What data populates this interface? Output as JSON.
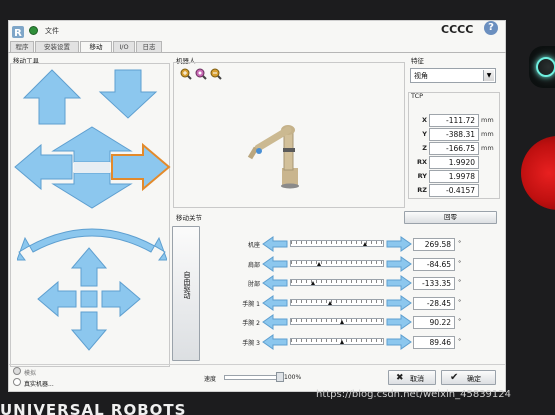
{
  "window": {
    "file_menu": "文件",
    "robot_name": "CCCC"
  },
  "tabs": [
    {
      "label": "程序"
    },
    {
      "label": "安装设置"
    },
    {
      "label": "移动"
    },
    {
      "label": "I/O"
    },
    {
      "label": "日志"
    }
  ],
  "move_tool": {
    "title": "移动工具"
  },
  "robot_view": {
    "title": "机器人"
  },
  "feature": {
    "title": "特征",
    "selected": "视角"
  },
  "tcp": {
    "title": "TCP",
    "rows": [
      {
        "label": "X",
        "value": "-111.72",
        "unit": "mm"
      },
      {
        "label": "Y",
        "value": "-388.31",
        "unit": "mm"
      },
      {
        "label": "Z",
        "value": "-166.75",
        "unit": "mm"
      },
      {
        "label": "RX",
        "value": "1.9920",
        "unit": ""
      },
      {
        "label": "RY",
        "value": "1.9978",
        "unit": ""
      },
      {
        "label": "RZ",
        "value": "-0.4157",
        "unit": ""
      }
    ]
  },
  "home_button": "回零",
  "joints": {
    "title": "移动关节",
    "freedrive_label": "自由驱动",
    "rows": [
      {
        "label": "机座",
        "value": "269.58",
        "unit": "°",
        "position": 0.8
      },
      {
        "label": "肩部",
        "value": "-84.65",
        "unit": "°",
        "position": 0.3
      },
      {
        "label": "肘部",
        "value": "-133.35",
        "unit": "°",
        "position": 0.24
      },
      {
        "label": "手腕 1",
        "value": "-28.45",
        "unit": "°",
        "position": 0.42
      },
      {
        "label": "手腕 2",
        "value": "90.22",
        "unit": "°",
        "position": 0.55
      },
      {
        "label": "手腕 3",
        "value": "89.46",
        "unit": "°",
        "position": 0.55
      }
    ]
  },
  "status": {
    "mode_small": "模拟",
    "mode_label": "真实机器..."
  },
  "speed": {
    "label": "速度",
    "percent": "100%",
    "value": 1.0
  },
  "cancel_button": "取消",
  "ok_button": "确定",
  "brand": "UNIVERSAL ROBOTS",
  "watermark": "https://blog.csdn.net/weixin_45839124"
}
